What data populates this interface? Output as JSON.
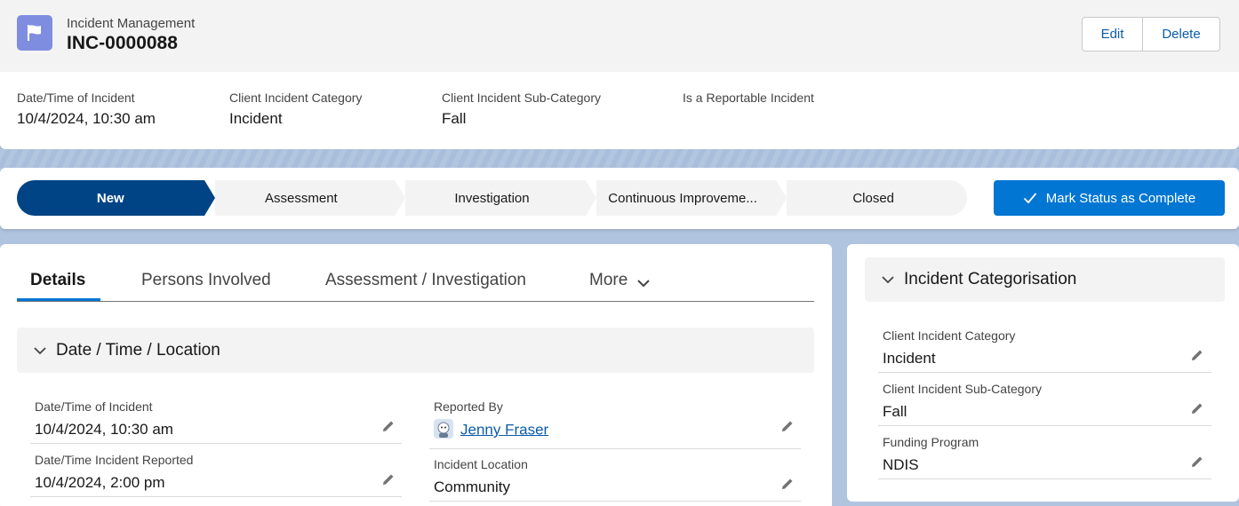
{
  "record": {
    "object_type": "Incident Management",
    "name": "INC-0000088",
    "edit_label": "Edit",
    "delete_label": "Delete"
  },
  "highlights": [
    {
      "label": "Date/Time of Incident",
      "value": "10/4/2024, 10:30 am"
    },
    {
      "label": "Client Incident Category",
      "value": "Incident"
    },
    {
      "label": "Client Incident Sub-Category",
      "value": "Fall"
    },
    {
      "label": "Is a Reportable Incident",
      "value": ""
    }
  ],
  "path": {
    "steps": [
      "New",
      "Assessment",
      "Investigation",
      "Continuous Improveme...",
      "Closed"
    ],
    "current_step": "New",
    "mark_complete_label": "Mark Status as Complete"
  },
  "tabs": [
    {
      "label": "Details",
      "active": true
    },
    {
      "label": "Persons Involved",
      "active": false
    },
    {
      "label": "Assessment / Investigation",
      "active": false
    },
    {
      "label": "More",
      "active": false
    }
  ],
  "details_section": {
    "title": "Date / Time / Location",
    "left_fields": [
      {
        "label": "Date/Time of Incident",
        "value": "10/4/2024, 10:30 am"
      },
      {
        "label": "Date/Time Incident Reported",
        "value": "10/4/2024, 2:00 pm"
      }
    ],
    "right_fields": [
      {
        "label": "Reported By",
        "value": "Jenny Fraser"
      },
      {
        "label": "Incident Location",
        "value": "Community"
      }
    ]
  },
  "categorisation": {
    "title": "Incident Categorisation",
    "fields": [
      {
        "label": "Client Incident Category",
        "value": "Incident"
      },
      {
        "label": "Client Incident Sub-Category",
        "value": "Fall"
      },
      {
        "label": "Funding Program",
        "value": "NDIS"
      }
    ]
  },
  "colors": {
    "brand": "#0176d3",
    "path_current": "#014486",
    "object_icon": "#7f8de1",
    "link": "#0b5cab"
  },
  "icons": {
    "object": "flag-icon",
    "edit_field": "pencil-icon",
    "section_toggle": "chevron-down-icon",
    "mark_complete": "check-icon"
  }
}
